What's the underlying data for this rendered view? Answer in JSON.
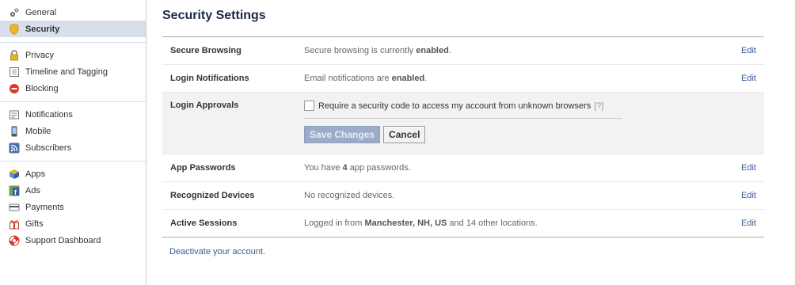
{
  "sidebar": {
    "groups": [
      [
        {
          "label": "General",
          "icon": "gears-icon"
        },
        {
          "label": "Security",
          "icon": "shield-icon",
          "active": true
        }
      ],
      [
        {
          "label": "Privacy",
          "icon": "lock-icon"
        },
        {
          "label": "Timeline and Tagging",
          "icon": "timeline-icon"
        },
        {
          "label": "Blocking",
          "icon": "blocking-icon"
        }
      ],
      [
        {
          "label": "Notifications",
          "icon": "notifications-icon"
        },
        {
          "label": "Mobile",
          "icon": "mobile-icon"
        },
        {
          "label": "Subscribers",
          "icon": "rss-icon"
        }
      ],
      [
        {
          "label": "Apps",
          "icon": "apps-icon"
        },
        {
          "label": "Ads",
          "icon": "ads-icon"
        },
        {
          "label": "Payments",
          "icon": "payments-icon"
        },
        {
          "label": "Gifts",
          "icon": "gift-icon"
        },
        {
          "label": "Support Dashboard",
          "icon": "lifebuoy-icon"
        }
      ]
    ]
  },
  "main": {
    "title": "Security Settings",
    "edit_label": "Edit",
    "rows": {
      "secure_browsing": {
        "label": "Secure Browsing",
        "desc_pre": "Secure browsing is currently ",
        "desc_bold": "enabled",
        "desc_post": "."
      },
      "login_notifications": {
        "label": "Login Notifications",
        "desc_pre": "Email notifications are ",
        "desc_bold": "enabled",
        "desc_post": "."
      },
      "login_approvals": {
        "label": "Login Approvals",
        "checkbox_label": "Require a security code to access my account from unknown browsers",
        "help": "[?]",
        "save_label": "Save Changes",
        "cancel_label": "Cancel",
        "checked": false
      },
      "app_passwords": {
        "label": "App Passwords",
        "desc_pre": "You have ",
        "desc_bold": "4",
        "desc_post": " app passwords."
      },
      "recognized_devices": {
        "label": "Recognized Devices",
        "desc": "No recognized devices."
      },
      "active_sessions": {
        "label": "Active Sessions",
        "desc_pre": "Logged in from ",
        "desc_bold": "Manchester, NH, US",
        "desc_post": " and 14 other locations."
      }
    },
    "footer_link": "Deactivate your account."
  },
  "colors": {
    "link": "#3b5998",
    "title": "#1c2a47",
    "active_bg": "#d8dfea"
  }
}
